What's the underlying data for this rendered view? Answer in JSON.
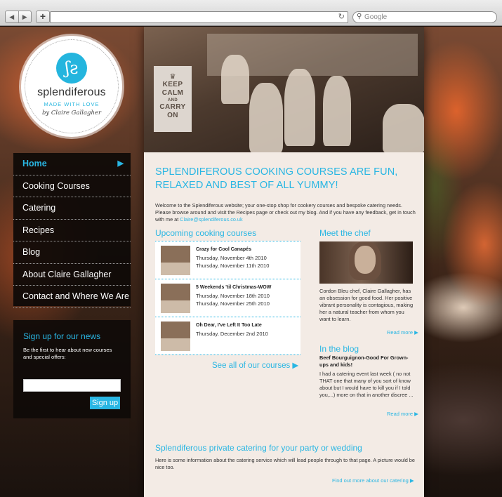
{
  "browser": {
    "back_glyph": "◀",
    "forward_glyph": "▶",
    "newtab_glyph": "+",
    "reload_glyph": "↻",
    "search_placeholder": "Google",
    "search_icon": "magnifier-icon"
  },
  "logo": {
    "mark": "ʃƨ",
    "name": "splendiferous",
    "tagline": "MADE WITH LOVE",
    "byline": "by Claire Gallagher"
  },
  "nav": {
    "items": [
      {
        "label": "Home"
      },
      {
        "label": "Cooking Courses"
      },
      {
        "label": "Catering"
      },
      {
        "label": "Recipes"
      },
      {
        "label": "Blog"
      },
      {
        "label": "About Claire Gallagher"
      },
      {
        "label": "Contact and Where We Are"
      }
    ],
    "active_arrow": "▶"
  },
  "signup": {
    "title": "Sign up for our news",
    "text": "Be the first to hear about new courses and special offers:",
    "button": "Sign up"
  },
  "hero": {
    "poster_crown": "♛",
    "poster_text": [
      "KEEP",
      "CALM",
      "AND",
      "CARRY",
      "ON"
    ]
  },
  "main": {
    "headline": "SPLENDIFEROUS COOKING COURSES ARE FUN, RELAXED AND BEST OF ALL YUMMY!",
    "intro_text": "Welcome to the Splendiferous website; your one-stop shop for cookery courses and bespoke catering needs. Please browse around and visit the Recipes page or check out my blog. And if you have any feedback, get in touch with me at",
    "intro_email": "Claire@splendiferous.co.uk",
    "upcoming_title": "Upcoming cooking courses",
    "courses": [
      {
        "title": "Crazy for Cool Canapés",
        "dates": [
          "Thursday, November 4th 2010",
          "Thursday, November 11th 2010"
        ]
      },
      {
        "title": "5 Weekends 'til Christmas-WOW",
        "dates": [
          "Thursday, November 18th 2010",
          "Thursday, November 25th 2010"
        ]
      },
      {
        "title": "Oh Dear, I've Left It Too Late",
        "dates": [
          "Thursday, December 2nd 2010"
        ]
      }
    ],
    "see_all": "See all of our courses ▶",
    "meet_title": "Meet the chef",
    "chef_text": "Cordon Bleu chef, Claire Gallagher, has an obsession for good food. Her positive vibrant personality is contagious, making her a natural teacher from whom you want to learn.",
    "read_more": "Read more ▶",
    "blog_title": "In the blog",
    "blog_post_title": "Beef Bourguignon-Good For Grown-ups and kids!",
    "blog_post_text": "I had a catering event last week ( no not THAT one that many of you sort of know about but I would have to kill you if I told you,...) more on that in another discree ...",
    "blog_read_more": "Read more ▶",
    "catering_title": "Splendiferous private catering for your party or wedding",
    "catering_text": "Here is some information about the catering service which will lead people through to that page. A picture would be nice too.",
    "catering_more": "Find out more about our catering ▶"
  },
  "colors": {
    "accent": "#29b6e3",
    "nav_bg": "#0e0a08",
    "content_bg": "#f3ebe5"
  }
}
